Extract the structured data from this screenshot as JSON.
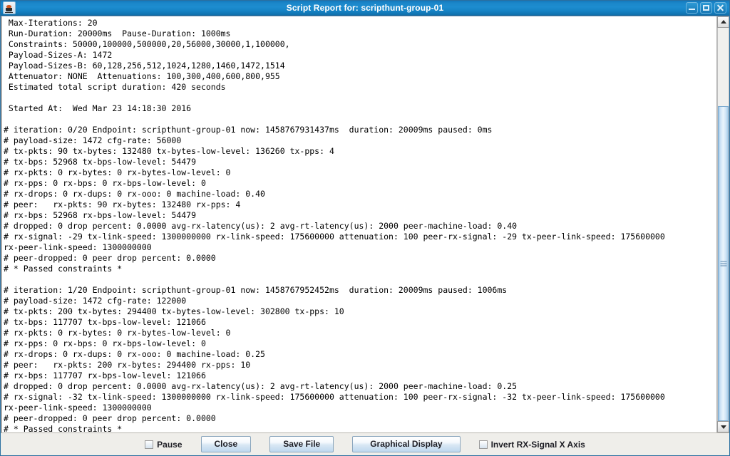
{
  "window": {
    "title": "Script Report for: scripthunt-group-01",
    "icon": "java-coffee-cup-icon",
    "controls": {
      "minimize": "minimize-icon",
      "maximize": "maximize-icon",
      "close": "close-icon"
    },
    "title_bar_color": "#1b87ca",
    "title_text_color": "#ffffff"
  },
  "report": {
    "text": " Max-Iterations: 20\n Run-Duration: 20000ms  Pause-Duration: 1000ms\n Constraints: 50000,100000,500000,20,56000,30000,1,100000,\n Payload-Sizes-A: 1472\n Payload-Sizes-B: 60,128,256,512,1024,1280,1460,1472,1514\n Attenuator: NONE  Attenuations: 100,300,400,600,800,955\n Estimated total script duration: 420 seconds\n\n Started At:  Wed Mar 23 14:18:30 2016\n\n# iteration: 0/20 Endpoint: scripthunt-group-01 now: 1458767931437ms  duration: 20009ms paused: 0ms\n# payload-size: 1472 cfg-rate: 56000\n# tx-pkts: 90 tx-bytes: 132480 tx-bytes-low-level: 136260 tx-pps: 4\n# tx-bps: 52968 tx-bps-low-level: 54479\n# rx-pkts: 0 rx-bytes: 0 rx-bytes-low-level: 0\n# rx-pps: 0 rx-bps: 0 rx-bps-low-level: 0\n# rx-drops: 0 rx-dups: 0 rx-ooo: 0 machine-load: 0.40\n# peer:   rx-pkts: 90 rx-bytes: 132480 rx-pps: 4\n# rx-bps: 52968 rx-bps-low-level: 54479\n# dropped: 0 drop percent: 0.0000 avg-rx-latency(us): 2 avg-rt-latency(us): 2000 peer-machine-load: 0.40\n# rx-signal: -29 tx-link-speed: 1300000000 rx-link-speed: 175600000 attenuation: 100 peer-rx-signal: -29 tx-peer-link-speed: 175600000\nrx-peer-link-speed: 1300000000\n# peer-dropped: 0 peer drop percent: 0.0000\n# * Passed constraints *\n\n# iteration: 1/20 Endpoint: scripthunt-group-01 now: 1458767952452ms  duration: 20009ms paused: 1006ms\n# payload-size: 1472 cfg-rate: 122000\n# tx-pkts: 200 tx-bytes: 294400 tx-bytes-low-level: 302800 tx-pps: 10\n# tx-bps: 117707 tx-bps-low-level: 121066\n# rx-pkts: 0 rx-bytes: 0 rx-bytes-low-level: 0\n# rx-pps: 0 rx-bps: 0 rx-bps-low-level: 0\n# rx-drops: 0 rx-dups: 0 rx-ooo: 0 machine-load: 0.25\n# peer:   rx-pkts: 200 rx-bytes: 294400 rx-pps: 10\n# rx-bps: 117707 rx-bps-low-level: 121066\n# dropped: 0 drop percent: 0.0000 avg-rx-latency(us): 2 avg-rt-latency(us): 2000 peer-machine-load: 0.25\n# rx-signal: -32 tx-link-speed: 1300000000 rx-link-speed: 175600000 attenuation: 100 peer-rx-signal: -32 tx-peer-link-speed: 175600000\nrx-peer-link-speed: 1300000000\n# peer-dropped: 0 peer drop percent: 0.0000\n# * Passed constraints *"
  },
  "scrollbar": {
    "up_arrow": "scroll-up-icon",
    "down_arrow": "scroll-down-icon"
  },
  "bottombar": {
    "pause_label": "Pause",
    "close_label": "Close",
    "save_file_label": "Save File",
    "graphical_display_label": "Graphical Display",
    "invert_axis_label": "Invert RX-Signal X Axis"
  }
}
